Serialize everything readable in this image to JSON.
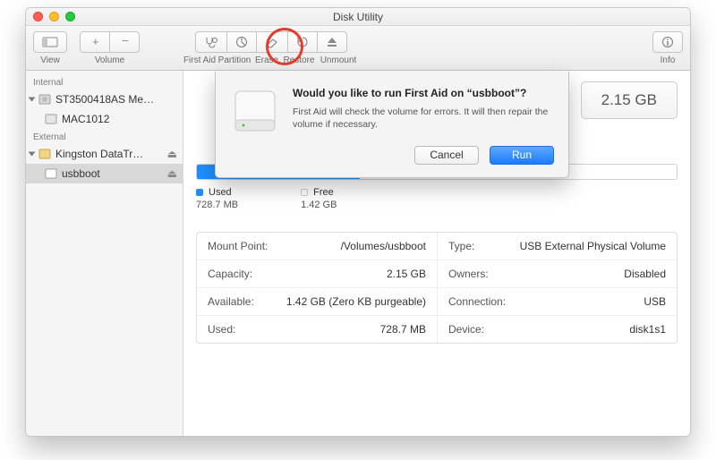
{
  "window": {
    "title": "Disk Utility"
  },
  "toolbar": {
    "view": "View",
    "volume": "Volume",
    "first_aid": "First Aid",
    "partition": "Partition",
    "erase": "Erase",
    "restore": "Restore",
    "unmount": "Unmount",
    "info": "Info"
  },
  "sidebar": {
    "heads": {
      "internal": "Internal",
      "external": "External"
    },
    "items": [
      "ST3500418AS Me…",
      "MAC1012",
      "Kingston DataTr…",
      "usbboot"
    ]
  },
  "main": {
    "capacity_display": "2.15 GB",
    "used_pct": 34,
    "legend": {
      "used_label": "Used",
      "used_val": "728.7 MB",
      "free_label": "Free",
      "free_val": "1.42 GB"
    },
    "info": {
      "mount_point_l": "Mount Point:",
      "mount_point_v": "/Volumes/usbboot",
      "capacity_l": "Capacity:",
      "capacity_v": "2.15 GB",
      "available_l": "Available:",
      "available_v": "1.42 GB (Zero KB purgeable)",
      "used_l": "Used:",
      "used_v": "728.7 MB",
      "type_l": "Type:",
      "type_v": "USB External Physical Volume",
      "owners_l": "Owners:",
      "owners_v": "Disabled",
      "connection_l": "Connection:",
      "connection_v": "USB",
      "device_l": "Device:",
      "device_v": "disk1s1"
    }
  },
  "dialog": {
    "title": "Would you like to run First Aid on “usbboot”?",
    "message": "First Aid will check the volume for errors. It will then repair the volume if necessary.",
    "cancel": "Cancel",
    "run": "Run"
  }
}
